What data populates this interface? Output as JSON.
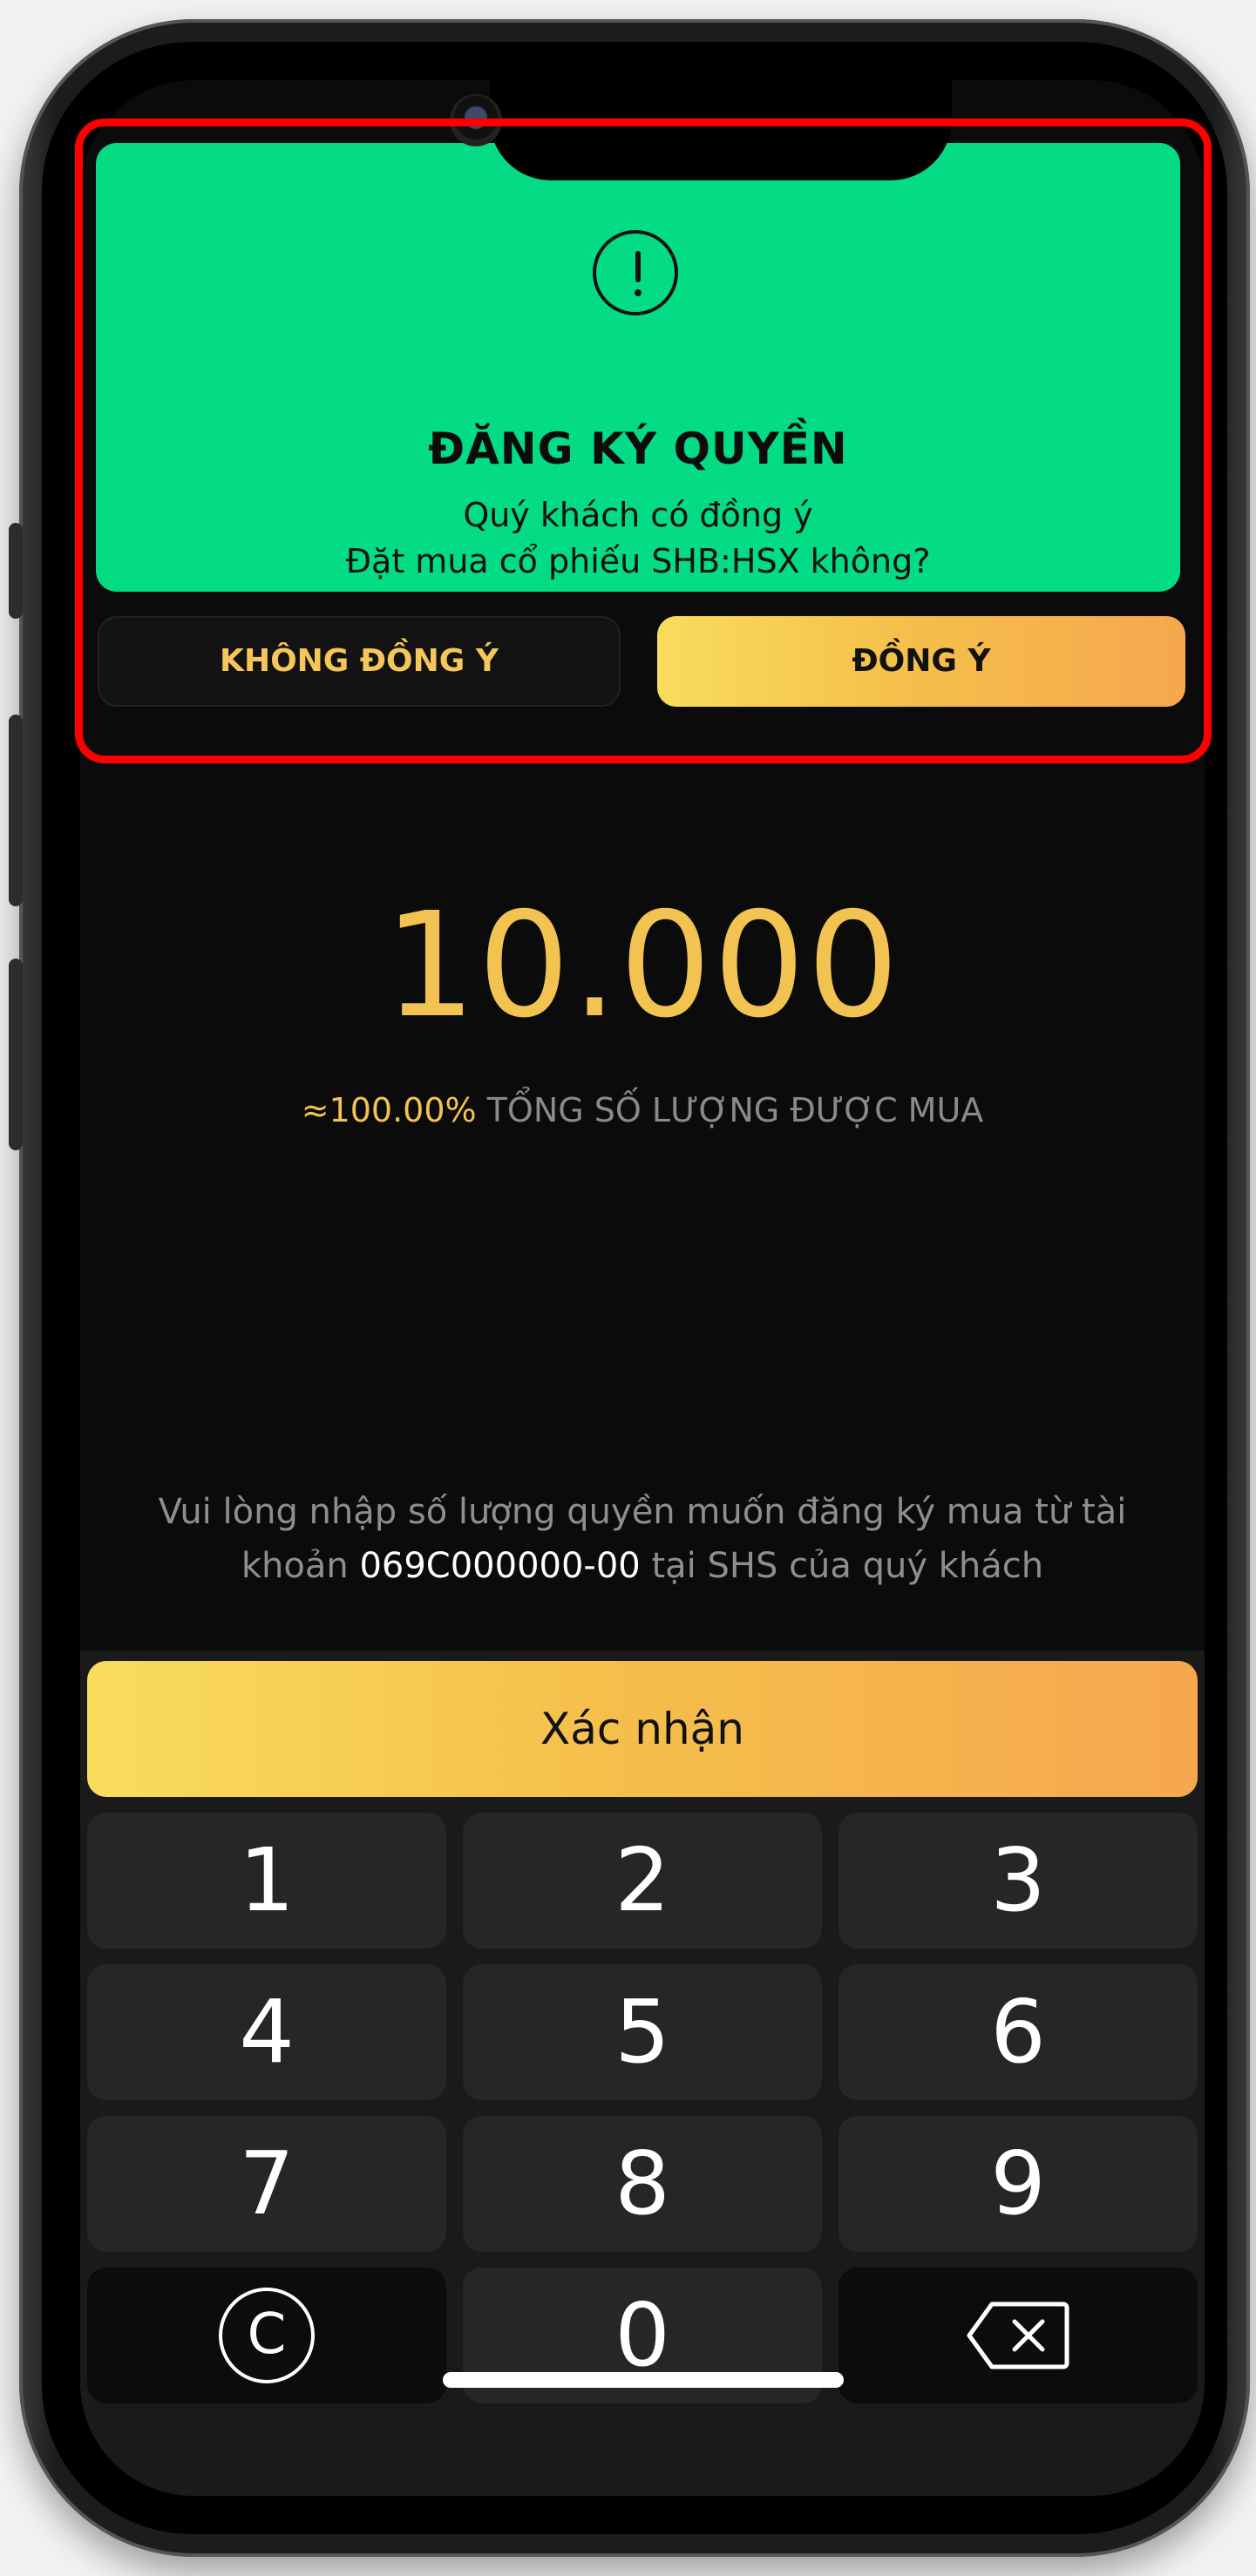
{
  "dialog": {
    "icon": "exclamation-circle-icon",
    "title": "ĐĂNG KÝ QUYỀN",
    "message_line1": "Quý khách có đồng ý",
    "message_line2": "Đặt mua cổ phiếu SHB:HSX không?",
    "decline_label": "KHÔNG ĐỒNG Ý",
    "accept_label": "ĐỒNG Ý",
    "colors": {
      "background": "#03dc84",
      "accent": "#f5c04c"
    }
  },
  "amount": {
    "value": "10.000",
    "percent": "≈100.00%",
    "label": "TỔNG SỐ LƯỢNG ĐƯỢC MUA"
  },
  "hint": {
    "line1": "Vui lòng nhập số lượng quyền muốn đăng ký mua từ tài",
    "line2_prefix": "khoản",
    "account": "069C000000-00",
    "line2_suffix": "tại SHS của quý khách"
  },
  "confirm_label": "Xác nhận",
  "keypad": {
    "keys": [
      "1",
      "2",
      "3",
      "4",
      "5",
      "6",
      "7",
      "8",
      "9",
      "0"
    ],
    "clear_icon": "clear-c-icon",
    "backspace_icon": "backspace-icon"
  },
  "highlight_color": "#ff0000"
}
